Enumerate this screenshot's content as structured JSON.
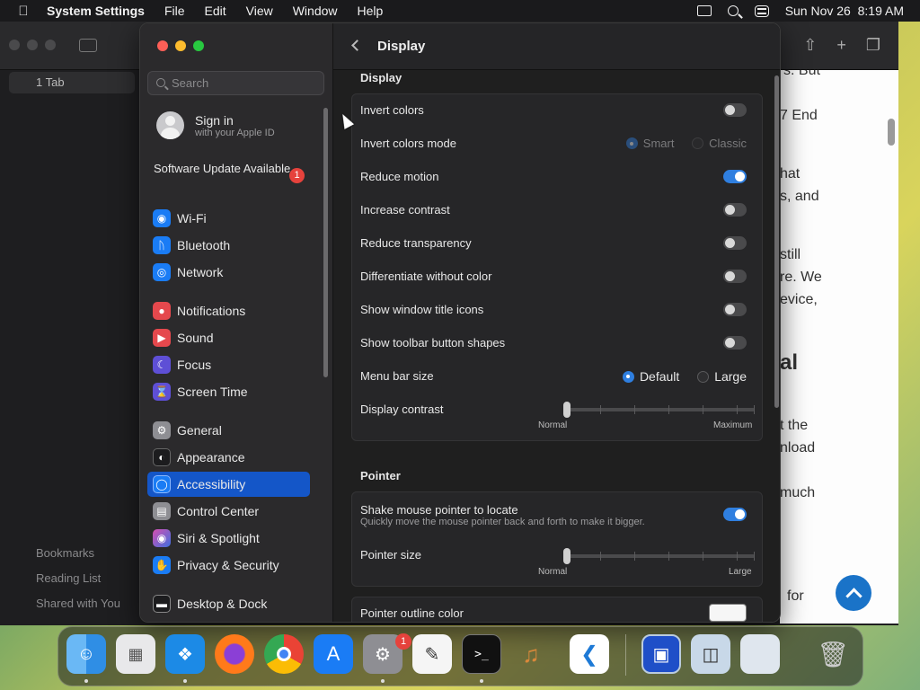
{
  "menubar": {
    "apple_icon": "apple-logo",
    "app_name": "System Settings",
    "items": [
      "File",
      "Edit",
      "View",
      "Window",
      "Help"
    ],
    "datetime": "Sun Nov 26  8:19 AM"
  },
  "background_window": {
    "tab_label": "1 Tab",
    "sidebar_links": [
      "Bookmarks",
      "Reading List",
      "Shared with You"
    ],
    "webpage_lines": [
      "s. But",
      "7 End",
      "hat",
      "s, and",
      "still",
      "re. We",
      "evice,",
      "al",
      "t the",
      "nload",
      "much",
      "for"
    ]
  },
  "sidebar": {
    "search_placeholder": "Search",
    "apple_id": {
      "title": "Sign in",
      "subtitle": "with your Apple ID"
    },
    "software_update": {
      "label": "Software Update Available",
      "badge": "1"
    },
    "items": [
      {
        "label": "Wi-Fi",
        "icon": "wifi-icon",
        "color": "#1a7cf5"
      },
      {
        "label": "Bluetooth",
        "icon": "bluetooth-icon",
        "color": "#1a7cf5"
      },
      {
        "label": "Network",
        "icon": "globe-icon",
        "color": "#1a7cf5"
      },
      {
        "label": "Notifications",
        "icon": "bell-icon",
        "color": "#e5484d"
      },
      {
        "label": "Sound",
        "icon": "speaker-icon",
        "color": "#e5484d"
      },
      {
        "label": "Focus",
        "icon": "moon-icon",
        "color": "#5e4fd6"
      },
      {
        "label": "Screen Time",
        "icon": "hourglass-icon",
        "color": "#5e4fd6"
      },
      {
        "label": "General",
        "icon": "gear-icon",
        "color": "#8e8e93"
      },
      {
        "label": "Appearance",
        "icon": "appearance-icon",
        "color": "#1c1c1e"
      },
      {
        "label": "Accessibility",
        "icon": "accessibility-icon",
        "color": "#1a7cf5"
      },
      {
        "label": "Control Center",
        "icon": "control-center-icon",
        "color": "#8e8e93"
      },
      {
        "label": "Siri & Spotlight",
        "icon": "siri-icon",
        "color": "#b04fd6"
      },
      {
        "label": "Privacy & Security",
        "icon": "hand-icon",
        "color": "#1a7cf5"
      },
      {
        "label": "Desktop & Dock",
        "icon": "dock-icon",
        "color": "#1c1c1e"
      }
    ],
    "selected": "Accessibility"
  },
  "content": {
    "title": "Display",
    "display_section": "Display",
    "invert_colors": {
      "label": "Invert colors",
      "on": false
    },
    "invert_colors_mode": {
      "label": "Invert colors mode",
      "options": [
        "Smart",
        "Classic"
      ],
      "selected": "Smart"
    },
    "reduce_motion": {
      "label": "Reduce motion",
      "on": true
    },
    "increase_contrast": {
      "label": "Increase contrast",
      "on": false
    },
    "reduce_transparency": {
      "label": "Reduce transparency",
      "on": false
    },
    "differentiate": {
      "label": "Differentiate without color",
      "on": false
    },
    "window_title_icons": {
      "label": "Show window title icons",
      "on": false
    },
    "toolbar_shapes": {
      "label": "Show toolbar button shapes",
      "on": false
    },
    "menu_bar_size": {
      "label": "Menu bar size",
      "options": [
        "Default",
        "Large"
      ],
      "selected": "Default"
    },
    "display_contrast": {
      "label": "Display contrast",
      "min_label": "Normal",
      "max_label": "Maximum",
      "value": 0
    },
    "pointer_section": "Pointer",
    "shake_pointer": {
      "label": "Shake mouse pointer to locate",
      "sublabel": "Quickly move the mouse pointer back and forth to make it bigger.",
      "on": true
    },
    "pointer_size": {
      "label": "Pointer size",
      "min_label": "Normal",
      "max_label": "Large",
      "value": 0
    },
    "pointer_outline": {
      "label": "Pointer outline color",
      "color": "#ffffff"
    }
  },
  "dock": {
    "apps": [
      {
        "name": "Finder",
        "icon": "finder-icon"
      },
      {
        "name": "Launchpad",
        "icon": "launchpad-icon"
      },
      {
        "name": "Safari",
        "icon": "safari-icon"
      },
      {
        "name": "Firefox",
        "icon": "firefox-icon"
      },
      {
        "name": "Chrome",
        "icon": "chrome-icon"
      },
      {
        "name": "App Store",
        "icon": "app-store-icon"
      },
      {
        "name": "System Settings",
        "icon": "system-settings-icon",
        "badge": "1"
      },
      {
        "name": "TextEdit",
        "icon": "textedit-icon"
      },
      {
        "name": "Terminal",
        "icon": "terminal-icon",
        "glyph": ">_"
      },
      {
        "name": "GarageBand",
        "icon": "garageband-icon"
      },
      {
        "name": "Visual Studio Code",
        "icon": "vscode-icon"
      },
      {
        "name": "Screen Sharing",
        "icon": "screen-sharing-icon"
      },
      {
        "name": "Preview",
        "icon": "preview-icon"
      },
      {
        "name": "Window",
        "icon": "window-icon"
      },
      {
        "name": "Trash",
        "icon": "trash-icon"
      }
    ]
  }
}
